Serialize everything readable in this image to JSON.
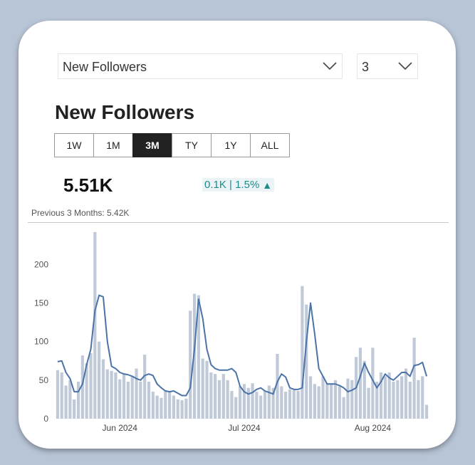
{
  "metric_select": {
    "value": "New Followers"
  },
  "period_select": {
    "value": "3"
  },
  "title": "New Followers",
  "tabs": [
    "1W",
    "1M",
    "3M",
    "TY",
    "1Y",
    "ALL"
  ],
  "active_tab": "3M",
  "kpi": {
    "value": "5.51K",
    "change": "0.1K | 1.5%",
    "change_color": "#1f8a8a",
    "change_bg": "#eaf4f6"
  },
  "previous_label": "Previous 3 Months: 5.42K",
  "colors": {
    "bar": "#bfc9d8",
    "line": "#4a73a8",
    "background": "#b8c5d6"
  },
  "chart_data": {
    "type": "bar",
    "yticks": [
      0,
      50,
      100,
      150,
      200
    ],
    "ylim": [
      0,
      240
    ],
    "x_labels": [
      {
        "label": "Jun 2024",
        "index": 15
      },
      {
        "label": "Jul 2024",
        "index": 45
      },
      {
        "label": "Aug 2024",
        "index": 76
      }
    ],
    "series": [
      {
        "type": "bar",
        "values": [
          63,
          60,
          43,
          50,
          25,
          48,
          82,
          72,
          85,
          242,
          100,
          77,
          64,
          62,
          60,
          51,
          58,
          48,
          55,
          65,
          48,
          83,
          48,
          35,
          30,
          27,
          37,
          35,
          30,
          25,
          24,
          26,
          140,
          162,
          160,
          78,
          75,
          60,
          58,
          50,
          58,
          50,
          36,
          28,
          42,
          45,
          40,
          46,
          35,
          30,
          36,
          43,
          40,
          84,
          42,
          35,
          38,
          37,
          36,
          172,
          148,
          55,
          45,
          42,
          55,
          46,
          46,
          50,
          42,
          28,
          52,
          50,
          80,
          92,
          75,
          40,
          92,
          48,
          60,
          55,
          60,
          48,
          50,
          55,
          65,
          48,
          105,
          50,
          55,
          18
        ],
        "bar_color": "#bfc9d8"
      },
      {
        "type": "line",
        "values": [
          74,
          75,
          60,
          52,
          35,
          35,
          45,
          70,
          90,
          140,
          160,
          158,
          100,
          68,
          65,
          60,
          58,
          57,
          55,
          52,
          50,
          56,
          58,
          56,
          45,
          40,
          36,
          35,
          36,
          33,
          30,
          30,
          40,
          90,
          155,
          130,
          90,
          70,
          65,
          63,
          63,
          63,
          65,
          60,
          42,
          35,
          32,
          34,
          38,
          40,
          36,
          34,
          32,
          48,
          58,
          54,
          40,
          38,
          38,
          40,
          100,
          150,
          110,
          65,
          55,
          45,
          45,
          45,
          43,
          40,
          35,
          37,
          40,
          55,
          72,
          60,
          50,
          40,
          48,
          58,
          53,
          50,
          55,
          60,
          60,
          55,
          69,
          70,
          73,
          55
        ]
      }
    ]
  }
}
